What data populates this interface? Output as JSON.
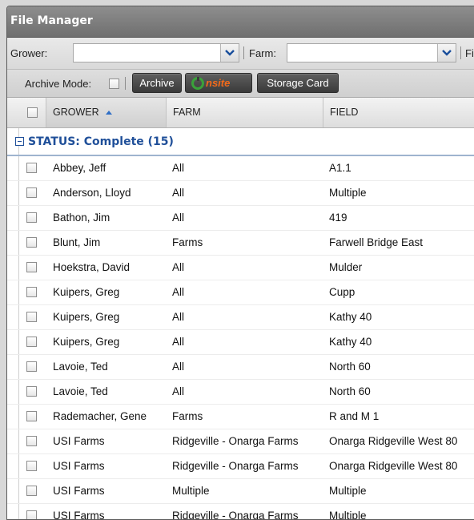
{
  "window": {
    "title": "File Manager"
  },
  "filters": {
    "grower_label": "Grower:",
    "grower_value": "",
    "farm_label": "Farm:",
    "farm_value": "",
    "field_label_partial": "Fi"
  },
  "toolbar": {
    "archive_mode_label": "Archive Mode:",
    "archive_button": "Archive",
    "onsite_button": "nsite",
    "storage_card_button": "Storage Card"
  },
  "columns": [
    {
      "label": "GROWER",
      "sorted": "asc"
    },
    {
      "label": "FARM"
    },
    {
      "label": "FIELD"
    }
  ],
  "group": {
    "label": "STATUS: Complete (15)"
  },
  "rows": [
    {
      "grower": "Abbey, Jeff",
      "farm": "All",
      "field": "A1.1"
    },
    {
      "grower": "Anderson, Lloyd",
      "farm": "All",
      "field": "Multiple"
    },
    {
      "grower": "Bathon, Jim",
      "farm": "All",
      "field": "419"
    },
    {
      "grower": "Blunt, Jim",
      "farm": "Farms",
      "field": "Farwell Bridge East"
    },
    {
      "grower": "Hoekstra, David",
      "farm": "All",
      "field": "Mulder"
    },
    {
      "grower": "Kuipers, Greg",
      "farm": "All",
      "field": "Cupp"
    },
    {
      "grower": "Kuipers, Greg",
      "farm": "All",
      "field": "Kathy 40"
    },
    {
      "grower": "Kuipers, Greg",
      "farm": "All",
      "field": "Kathy 40"
    },
    {
      "grower": "Lavoie, Ted",
      "farm": "All",
      "field": "North 60"
    },
    {
      "grower": "Lavoie, Ted",
      "farm": "All",
      "field": "North 60"
    },
    {
      "grower": "Rademacher, Gene",
      "farm": "Farms",
      "field": "R and M 1"
    },
    {
      "grower": "USI Farms",
      "farm": "Ridgeville - Onarga Farms",
      "field": "Onarga Ridgeville West 80"
    },
    {
      "grower": "USI Farms",
      "farm": "Ridgeville - Onarga Farms",
      "field": "Onarga Ridgeville West 80"
    },
    {
      "grower": "USI Farms",
      "farm": "Multiple",
      "field": "Multiple"
    },
    {
      "grower": "USI Farms",
      "farm": "Ridgeville - Onarga Farms",
      "field": "Multiple"
    }
  ],
  "colors": {
    "title_bg": "#7d7d7d",
    "group_text": "#1f4f99",
    "onsite_orange": "#f26a1b",
    "onsite_green": "#3aa23a"
  }
}
